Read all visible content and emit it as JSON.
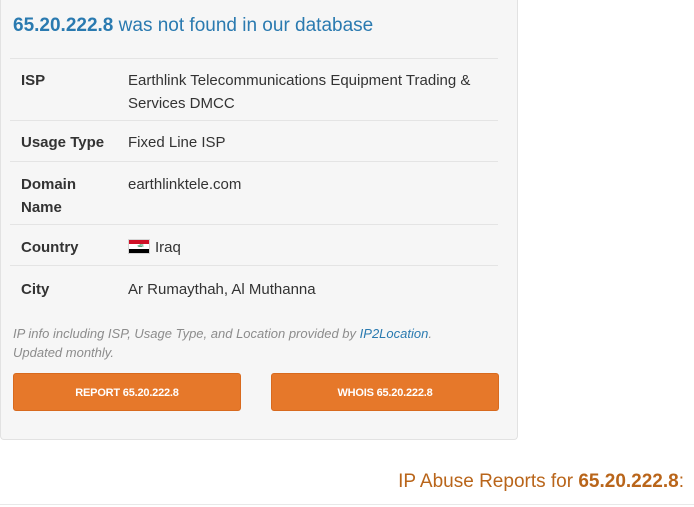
{
  "headline": {
    "ip": "65.20.222.8",
    "suffix": "was not found in our database"
  },
  "details": {
    "isp_label": "ISP",
    "isp_value": "Earthlink Telecommunications Equipment Trading & Services DMCC",
    "usage_label": "Usage Type",
    "usage_value": "Fixed Line ISP",
    "domain_label": "Domain Name",
    "domain_value": "earthlinktele.com",
    "country_label": "Country",
    "country_value": "Iraq",
    "country_flag_icon": "iraq-flag-icon",
    "city_label": "City",
    "city_value": "Ar Rumaythah, Al Muthanna"
  },
  "note": {
    "text_before": "IP info including ISP, Usage Type, and Location provided by ",
    "link": "IP2Location",
    "text_after": ". Updated monthly."
  },
  "buttons": {
    "report": "REPORT 65.20.222.8",
    "whois": "WHOIS 65.20.222.8"
  },
  "abuse": {
    "prefix": "IP Abuse Reports for ",
    "ip": "65.20.222.8",
    "suffix": ":"
  },
  "colors": {
    "link_blue": "#2a7ab0",
    "button_orange": "#e6782a",
    "heading_orange": "#b9651a"
  }
}
